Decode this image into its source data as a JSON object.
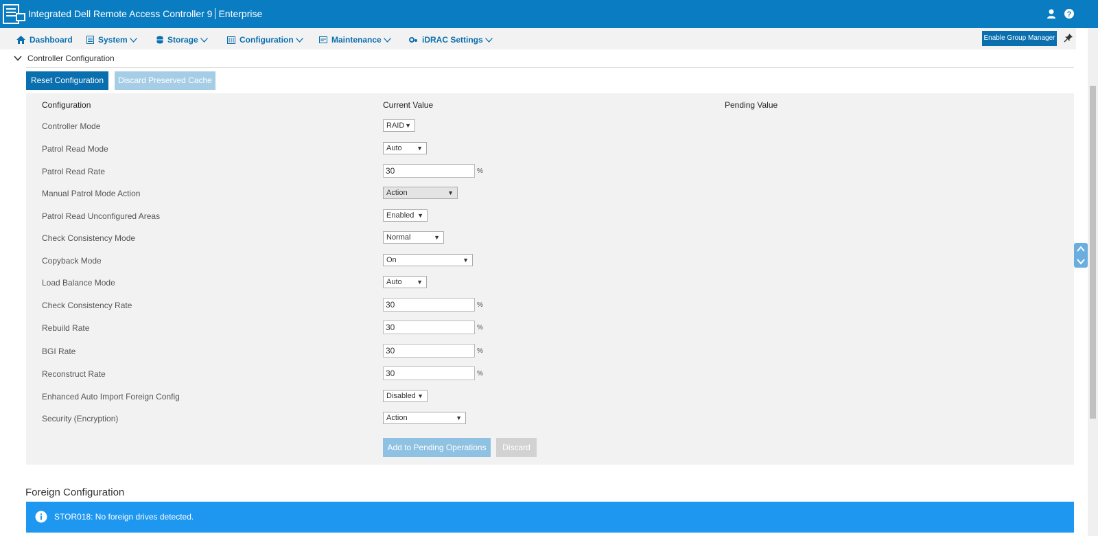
{
  "header": {
    "title": "Integrated Dell Remote Access Controller 9",
    "edition": "Enterprise",
    "icons": [
      "user-icon",
      "help-icon"
    ]
  },
  "nav": {
    "items": [
      {
        "label": "Dashboard",
        "icon": "home-icon"
      },
      {
        "label": "System",
        "icon": "server-icon"
      },
      {
        "label": "Storage",
        "icon": "database-icon"
      },
      {
        "label": "Configuration",
        "icon": "config-icon"
      },
      {
        "label": "Maintenance",
        "icon": "maintenance-icon"
      },
      {
        "label": "iDRAC Settings",
        "icon": "gears-icon"
      }
    ],
    "group_manager_label": "Enable Group Manager"
  },
  "controller_config": {
    "title": "Controller Configuration",
    "reset_label": "Reset Configuration",
    "discard_cache_label": "Discard Preserved Cache",
    "columns": [
      "Configuration",
      "Current Value",
      "Pending Value"
    ],
    "rows": [
      {
        "label": "Controller Mode",
        "value": "RAID",
        "type": "select"
      },
      {
        "label": "Patrol Read Mode",
        "value": "Auto",
        "type": "select"
      },
      {
        "label": "Patrol Read Rate",
        "value": "30",
        "type": "text",
        "unit": "%"
      },
      {
        "label": "Manual Patrol Mode Action",
        "value": "Action",
        "type": "select",
        "disabled": true
      },
      {
        "label": "Patrol Read Unconfigured Areas",
        "value": "Enabled",
        "type": "select"
      },
      {
        "label": "Check Consistency Mode",
        "value": "Normal",
        "type": "select"
      },
      {
        "label": "Copyback Mode",
        "value": "On",
        "type": "select"
      },
      {
        "label": "Load Balance Mode",
        "value": "Auto",
        "type": "select"
      },
      {
        "label": "Check Consistency Rate",
        "value": "30",
        "type": "text",
        "unit": "%"
      },
      {
        "label": "Rebuild Rate",
        "value": "30",
        "type": "text",
        "unit": "%"
      },
      {
        "label": "BGI Rate",
        "value": "30",
        "type": "text",
        "unit": "%"
      },
      {
        "label": "Reconstruct Rate",
        "value": "30",
        "type": "text",
        "unit": "%"
      },
      {
        "label": "Enhanced Auto Import Foreign Config",
        "value": "Disabled",
        "type": "select"
      },
      {
        "label": "Security (Encryption)",
        "value": "Action",
        "type": "select"
      }
    ],
    "add_pending_label": "Add to Pending Operations",
    "discard_label": "Discard"
  },
  "foreign_config": {
    "title": "Foreign Configuration",
    "message": "STOR018: No foreign drives detected."
  },
  "colors": {
    "header_bg": "#0a7cc1",
    "primary_button": "#0a6fae",
    "info_bar": "#1e97f0"
  }
}
